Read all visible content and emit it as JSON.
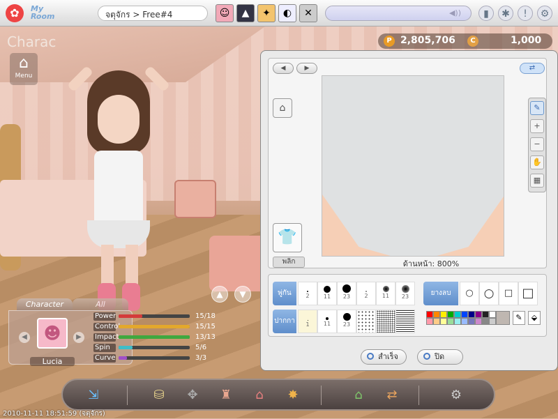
{
  "topbar": {
    "logo_text_line1": "My",
    "logo_text_line2": "Room",
    "breadcrumb": "จตุจักร > Free#4",
    "quick_slots": [
      "character-avatar",
      "outfit",
      "card",
      "emote",
      "close"
    ]
  },
  "currency": {
    "points": "2,805,706",
    "cash": "1,000"
  },
  "left": {
    "title": "Charac",
    "menu_label": "Menu"
  },
  "editor": {
    "zoom_prefix": "ด้านหน้า:",
    "zoom_value": "800%",
    "flip_label": "พลิก",
    "brush_tab": "พู่กัน",
    "eraser_tab": "ยางลบ",
    "pen_tab": "ปากกา",
    "brushes": [
      {
        "size": "2"
      },
      {
        "size": "11"
      },
      {
        "size": "23"
      },
      {
        "size": "2"
      },
      {
        "size": "11"
      },
      {
        "size": "23"
      }
    ],
    "pens": [
      {
        "size": "1"
      },
      {
        "size": "11"
      },
      {
        "size": "23"
      }
    ],
    "palette": [
      "#ff0000",
      "#ff8800",
      "#ffee00",
      "#00aa00",
      "#00cccc",
      "#0044ff",
      "#000088",
      "#880088",
      "#222222",
      "#ffffff",
      "#ff99aa",
      "#ffcc88",
      "#ffff99",
      "#99dd99",
      "#99eeee",
      "#99bbff",
      "#7777bb",
      "#cc88cc",
      "#888888",
      "#cccccc"
    ],
    "current_color": "#bfb7b1",
    "ok_label": "สำเร็จ",
    "close_label": "ปิด"
  },
  "character": {
    "tab_character": "Character",
    "tab_all": "All",
    "name": "Lucia",
    "stats": [
      {
        "label": "Power",
        "value": "15/18",
        "fill": 0.33,
        "color": "#d43b3b"
      },
      {
        "label": "Control",
        "value": "15/15",
        "fill": 1.0,
        "color": "#e3a82c"
      },
      {
        "label": "Impact",
        "value": "13/13",
        "fill": 1.0,
        "color": "#3fa83f"
      },
      {
        "label": "Spin",
        "value": "5/6",
        "fill": 0.2,
        "color": "#3fbdc8"
      },
      {
        "label": "Curve",
        "value": "3/3",
        "fill": 0.12,
        "color": "#a050c8"
      }
    ]
  },
  "timestamp": "2010-11-11 18:51:59 (จตุจักร)"
}
